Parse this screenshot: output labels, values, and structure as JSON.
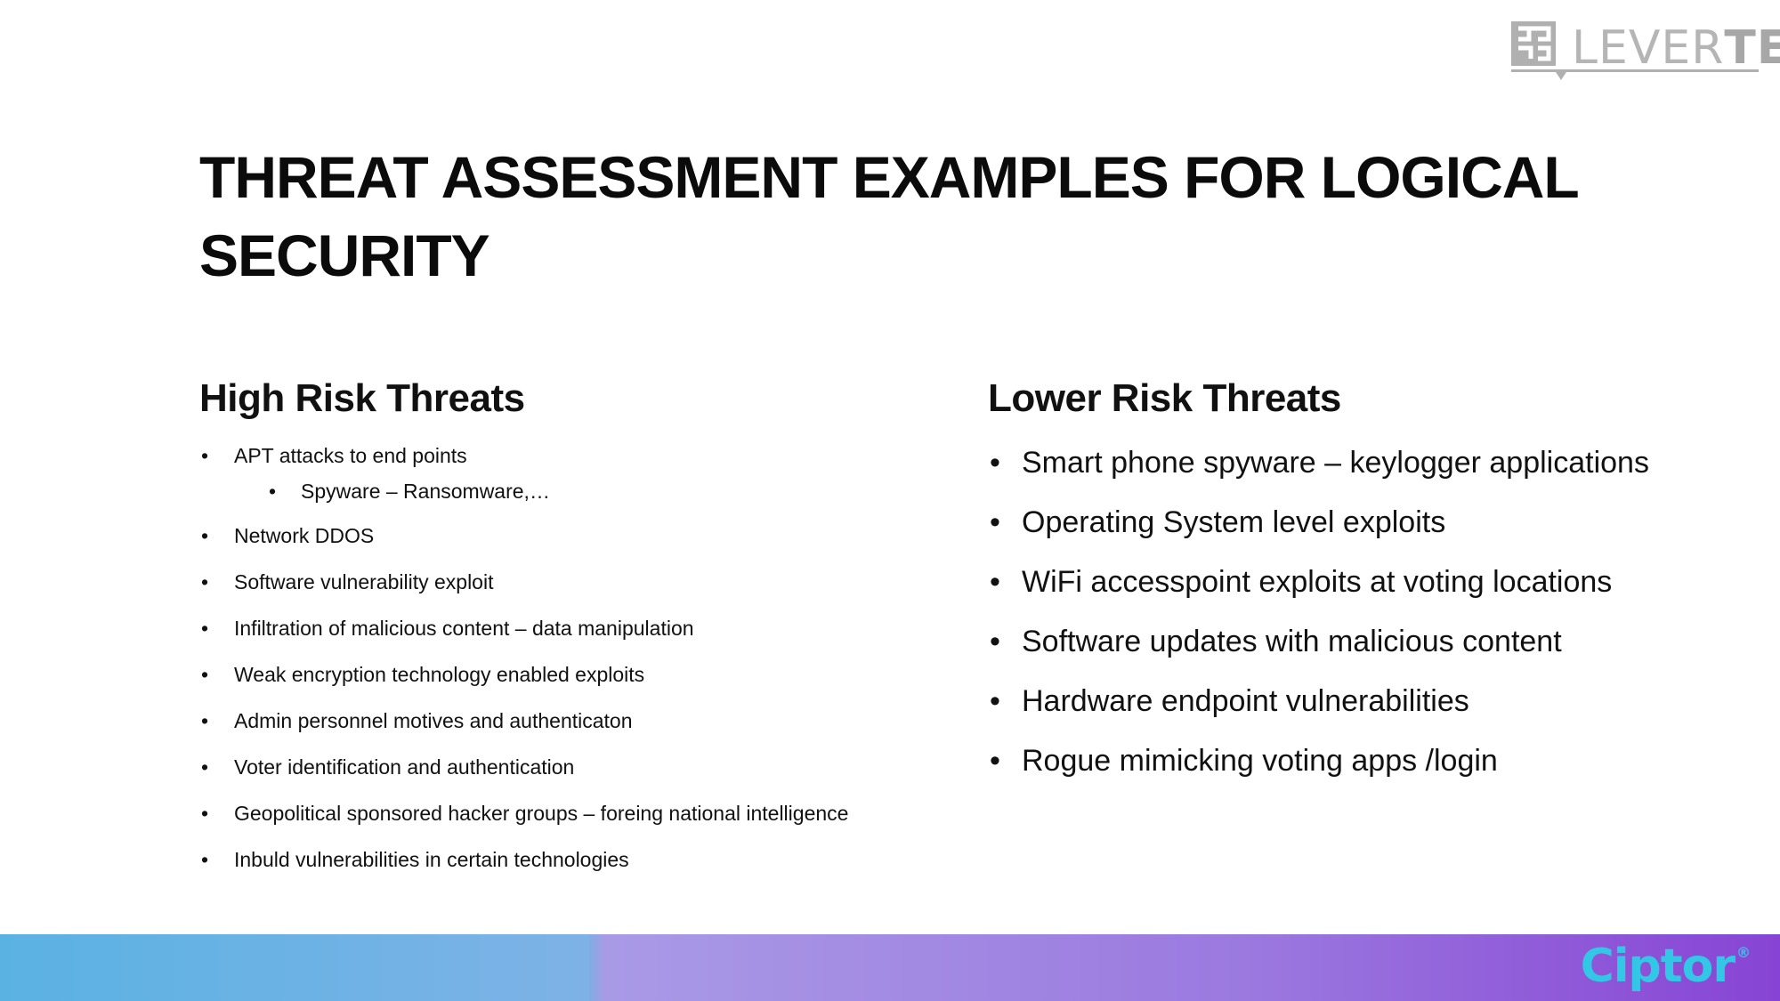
{
  "logo": {
    "text_light": "LEVER",
    "text_bold": "TECH"
  },
  "title": "THREAT ASSESSMENT EXAMPLES FOR LOGICAL SECURITY",
  "high_risk": {
    "heading": "High Risk Threats",
    "items": [
      "APT attacks to end points",
      "Spyware – Ransomware,…",
      "Network DDOS",
      "Software vulnerability exploit",
      "Infiltration of malicious content – data manipulation",
      "Weak encryption technology enabled exploits",
      "Admin personnel motives and authenticaton",
      "Voter identification and authentication",
      "Geopolitical sponsored hacker groups – foreing national intelligence",
      "Inbuld vulnerabilities in certain technologies"
    ]
  },
  "lower_risk": {
    "heading": "Lower Risk Threats",
    "items": [
      "Smart phone spyware – keylogger applications",
      "Operating System level exploits",
      "WiFi accesspoint exploits at voting locations",
      "Software updates with malicious content",
      "Hardware endpoint vulnerabilities",
      "Rogue mimicking voting apps /login"
    ]
  },
  "footer": {
    "brand": "Ciptor",
    "brand_mark": "®"
  },
  "bullet_char": "•",
  "colors": {
    "footer_left": "#5ab2e3",
    "footer_right": "#8744d4",
    "ciptor": "#33c7e6",
    "levertech_grey": "#b0b0b0"
  }
}
